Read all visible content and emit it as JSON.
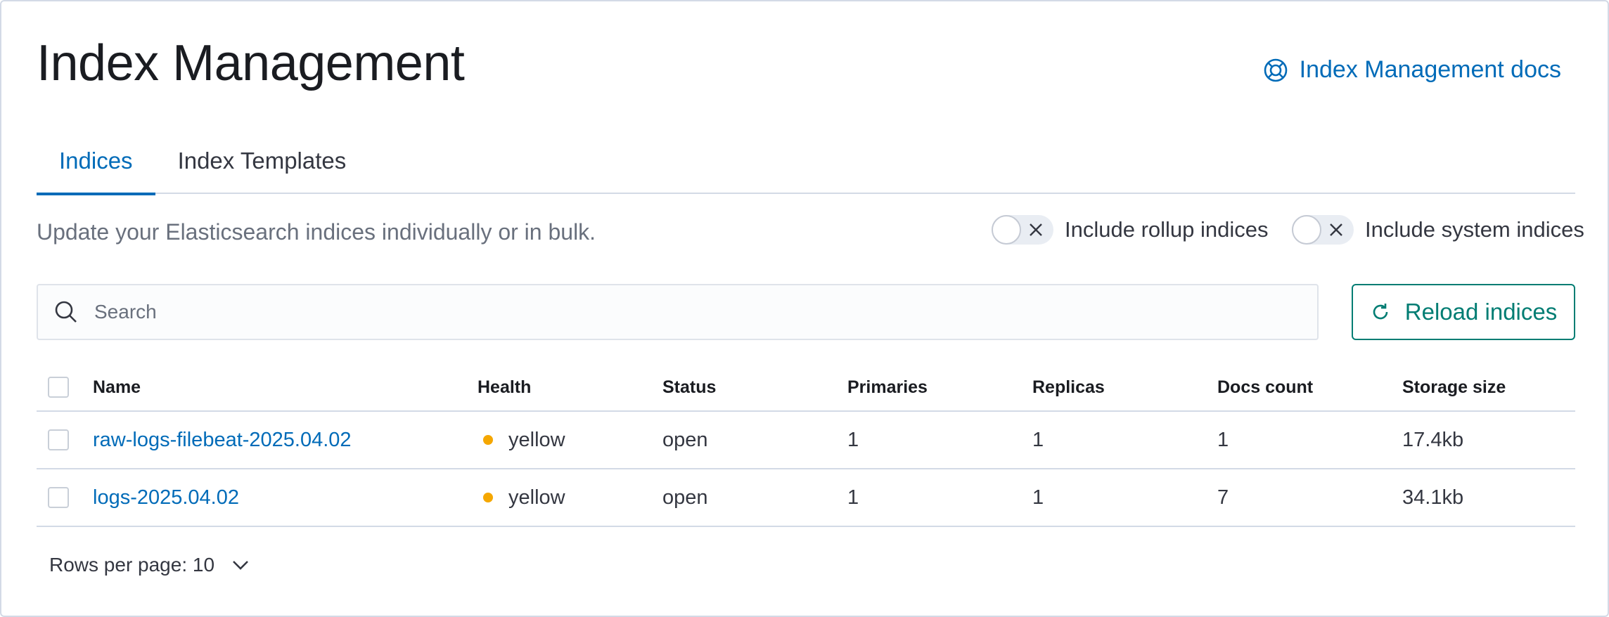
{
  "header": {
    "title": "Index Management",
    "docs_link": "Index Management docs"
  },
  "tabs": [
    {
      "label": "Indices",
      "active": true
    },
    {
      "label": "Index Templates",
      "active": false
    }
  ],
  "description": "Update your Elasticsearch indices individually or in bulk.",
  "toggles": {
    "rollup": {
      "label": "Include rollup indices",
      "on": false
    },
    "system": {
      "label": "Include system indices",
      "on": false
    }
  },
  "search": {
    "placeholder": "Search",
    "value": ""
  },
  "reload_button": {
    "label": "Reload indices"
  },
  "table": {
    "columns": [
      "Name",
      "Health",
      "Status",
      "Primaries",
      "Replicas",
      "Docs count",
      "Storage size"
    ],
    "rows": [
      {
        "name": "raw-logs-filebeat-2025.04.02",
        "health": "yellow",
        "status": "open",
        "primaries": "1",
        "replicas": "1",
        "docs_count": "1",
        "storage_size": "17.4kb"
      },
      {
        "name": "logs-2025.04.02",
        "health": "yellow",
        "status": "open",
        "primaries": "1",
        "replicas": "1",
        "docs_count": "7",
        "storage_size": "34.1kb"
      }
    ]
  },
  "pagination": {
    "label": "Rows per page: 10"
  },
  "colors": {
    "link": "#006bb8",
    "primary_button": "#017d73",
    "health_yellow": "#f5a700",
    "border": "#d3dae6"
  }
}
